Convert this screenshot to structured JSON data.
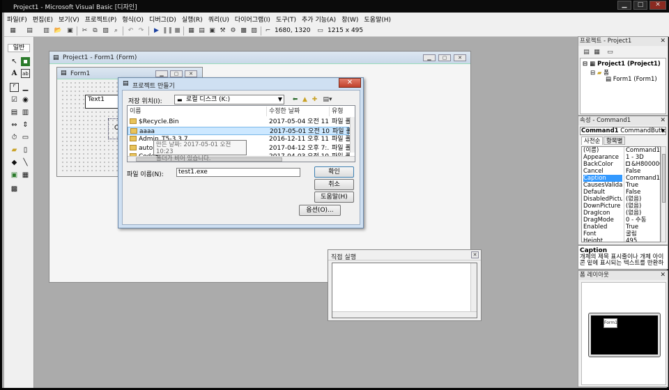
{
  "window": {
    "title": "Project1 - Microsoft Visual Basic [디자인]"
  },
  "menu": [
    "파일(F)",
    "편집(E)",
    "보기(V)",
    "프로젝트(P)",
    "형식(O)",
    "디버그(D)",
    "실행(R)",
    "쿼리(U)",
    "다이어그램(I)",
    "도구(T)",
    "추가 기능(A)",
    "창(W)",
    "도움말(H)"
  ],
  "toolbar": {
    "position": "1680, 1320",
    "size": "1215 x 495"
  },
  "toolbox": {
    "header": "일반"
  },
  "designer": {
    "title": "Project1 - Form1 (Form)",
    "form_title": "Form1",
    "textbox": "Text1",
    "command_partial": "C"
  },
  "dialog": {
    "title": "프로젝트 만들기",
    "save_in_label": "저장 위치(I):",
    "save_in_value": "로컬 디스크 (K:)",
    "columns": [
      "이름",
      "수정한 날짜",
      "유형"
    ],
    "rows": [
      {
        "name": "$Recycle.Bin",
        "date": "2017-05-04 오전 11...",
        "type": "파일 폴"
      },
      {
        "name": "aaaa",
        "date": "2017-05-01 오전 10...",
        "type": "파일 폴"
      },
      {
        "name": "Admin_T5-3.3.7",
        "date": "2016-12-11 오후 11...",
        "type": "파일 폴"
      },
      {
        "name": "autolot",
        "date": "2017-04-12 오후 7:...",
        "type": "파일 폴"
      },
      {
        "name": "CodeS...",
        "date": "2017-04-03 오전 10...",
        "type": "파일 폴"
      }
    ],
    "tooltip_line1": "만든 날짜: 2017-05-01 오전 10:23",
    "tooltip_line2": "폴더가 비어 있습니다.",
    "filename_label": "파일 이름(N):",
    "filename_value": "test1.exe",
    "ok": "확인",
    "cancel": "취소",
    "help": "도움말(H)",
    "options": "옵션(O)..."
  },
  "immediate": {
    "title": "직접 실행"
  },
  "project_panel": {
    "title": "프로젝트 - Project1",
    "root": "Project1 (Project1)",
    "folder": "폼",
    "item": "Form1 (Form1)"
  },
  "properties_panel": {
    "title": "속성 - Command1",
    "object_name": "Command1",
    "object_type": "CommandButton",
    "tabs": [
      "사전순",
      "항목별"
    ],
    "rows": [
      [
        "(이름)",
        "Command1"
      ],
      [
        "Appearance",
        "1 - 3D"
      ],
      [
        "BackColor",
        "&H8000000F"
      ],
      [
        "Cancel",
        "False"
      ],
      [
        "Caption",
        "Command1"
      ],
      [
        "CausesValidat",
        "True"
      ],
      [
        "Default",
        "False"
      ],
      [
        "DisabledPictur",
        "(없음)"
      ],
      [
        "DownPicture",
        "(없음)"
      ],
      [
        "DragIcon",
        "(없음)"
      ],
      [
        "DragMode",
        "0 - 수동"
      ],
      [
        "Enabled",
        "True"
      ],
      [
        "Font",
        "굴림"
      ],
      [
        "Height",
        "495"
      ]
    ],
    "selected_row": 4
  },
  "prop_desc": {
    "name": "Caption",
    "text": "개체의 제목 표시줄이나 개체 아이콘 밑에 표시되는 텍스트를 반환하"
  },
  "layout_panel": {
    "title": "폼 레이아웃",
    "form_label": "Form1"
  },
  "colors": {
    "selection": "#3399ff",
    "folder": "#e8c35a"
  }
}
